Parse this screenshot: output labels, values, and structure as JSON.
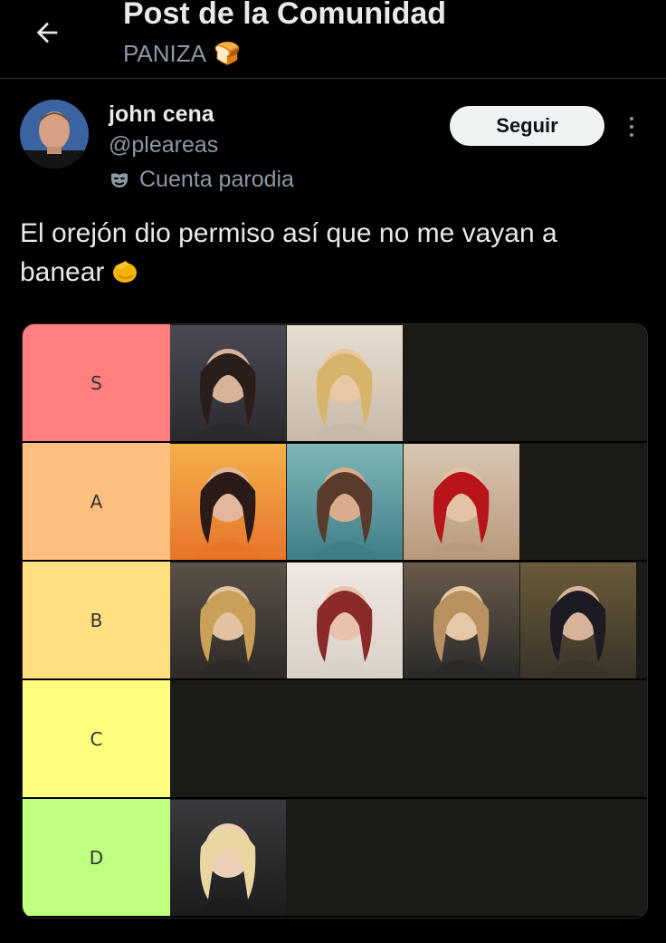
{
  "header": {
    "title": "Post de la Comunidad",
    "community": "PANIZA",
    "community_emoji": "🍞"
  },
  "author": {
    "name": "john cena",
    "handle": "@pleareas",
    "label": "Cuenta parodia"
  },
  "actions": {
    "follow_label": "Seguir"
  },
  "post": {
    "text": "El orejón dio permiso así que no me vayan a banear"
  },
  "tierlist": {
    "tiers": [
      {
        "label": "S",
        "color": "#ff7f7f",
        "items": [
          "photo-woman-dark-hair",
          "photo-woman-blonde-mirror"
        ]
      },
      {
        "label": "A",
        "color": "#ffbf7f",
        "items": [
          "photo-woman-sunset",
          "photo-woman-beach",
          "photo-woman-roses"
        ]
      },
      {
        "label": "B",
        "color": "#ffdf7f",
        "items": [
          "photo-woman-elevator",
          "photo-woman-red-hair",
          "photo-woman-car",
          "photo-woman-kimono"
        ]
      },
      {
        "label": "C",
        "color": "#ffff7f",
        "items": []
      },
      {
        "label": "D",
        "color": "#bfff7f",
        "items": [
          "photo-woman-gaming-chair"
        ]
      }
    ]
  },
  "colors": {
    "background": "#000000",
    "text_primary": "#e7e9ea",
    "text_secondary": "#8b98a5",
    "follow_bg": "#eff3f4"
  }
}
